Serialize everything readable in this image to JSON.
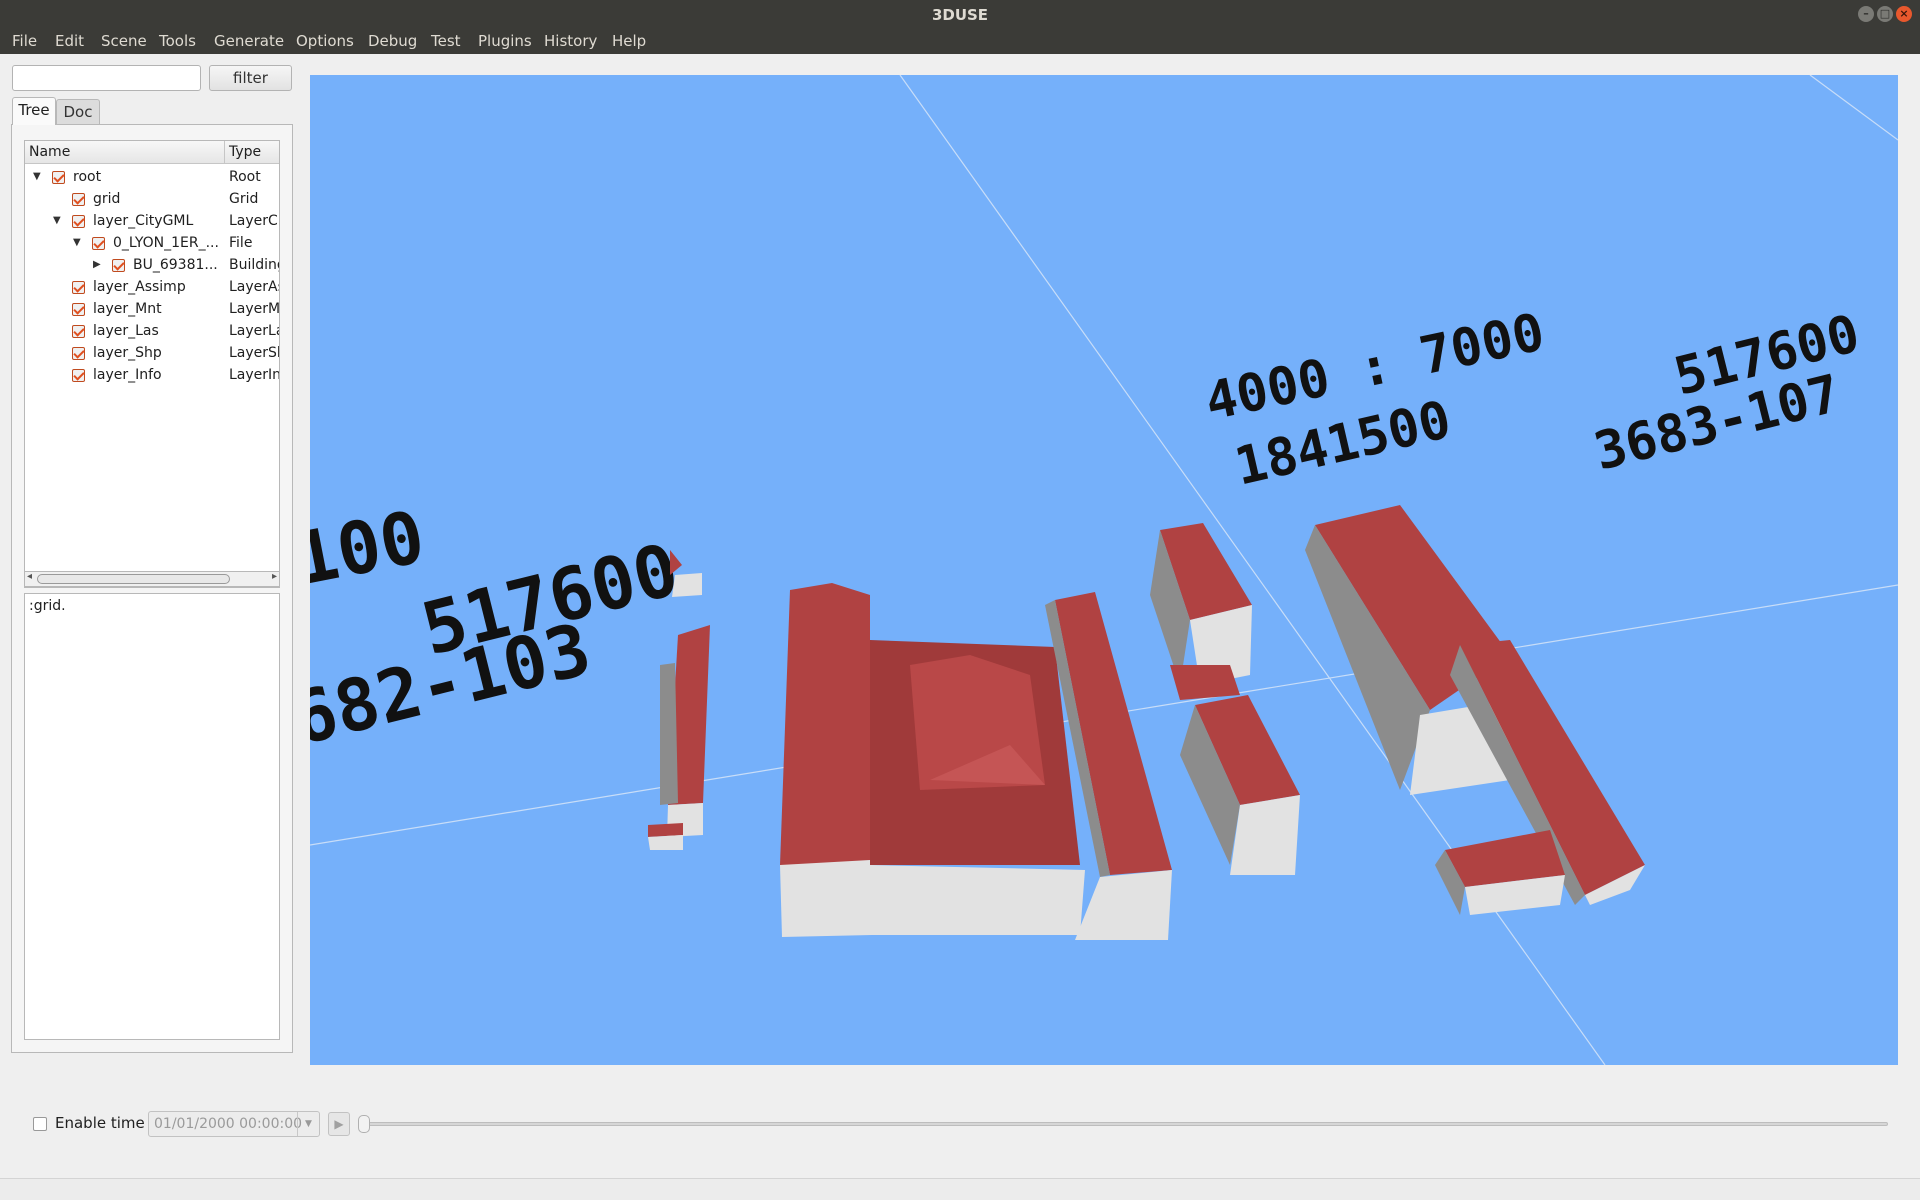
{
  "window": {
    "title": "3DUSE"
  },
  "menu": {
    "items": [
      "File",
      "Edit",
      "Scene",
      "Tools",
      "Generate",
      "Options",
      "Debug",
      "Test",
      "Plugins",
      "History",
      "Help"
    ]
  },
  "search": {
    "value": "",
    "filter_label": "filter"
  },
  "tabs": {
    "tree": "Tree",
    "doc": "Doc",
    "active": "Tree"
  },
  "tree": {
    "columns": {
      "name": "Name",
      "type": "Type"
    },
    "rows": [
      {
        "name": "root",
        "type": "Root",
        "checked": true,
        "expanded": true
      },
      {
        "name": "grid",
        "type": "Grid",
        "checked": true
      },
      {
        "name": "layer_CityGML",
        "type": "LayerCi",
        "checked": true,
        "expanded": true
      },
      {
        "name": "0_LYON_1ER_...",
        "type": "File",
        "checked": true,
        "expanded": true
      },
      {
        "name": "BU_69381...",
        "type": "Building",
        "checked": true,
        "expanded": false
      },
      {
        "name": "layer_Assimp",
        "type": "LayerAs",
        "checked": true
      },
      {
        "name": "layer_Mnt",
        "type": "LayerMi",
        "checked": true
      },
      {
        "name": "layer_Las",
        "type": "LayerLa",
        "checked": true
      },
      {
        "name": "layer_Shp",
        "type": "LayerSh",
        "checked": true
      },
      {
        "name": "layer_Info",
        "type": "LayerIn",
        "checked": true
      }
    ]
  },
  "doc": {
    "text": ":grid."
  },
  "viewport": {
    "background_color": "#75b0fa",
    "grid_labels": {
      "left_1": "100",
      "left_2": "517600",
      "left_3": "682-103",
      "right_1": "4000 : 7000",
      "right_2": "1841500",
      "right_3": "517600",
      "right_4": "3683-107"
    }
  },
  "time": {
    "enable_label": "Enable time",
    "enabled": false,
    "date": "01/01/2000 00:00:00"
  },
  "colors": {
    "roof": "#b04242",
    "wall_light": "#e2e2e2",
    "wall_dark": "#8c8c8c",
    "checkbox_accent": "#e05020"
  }
}
